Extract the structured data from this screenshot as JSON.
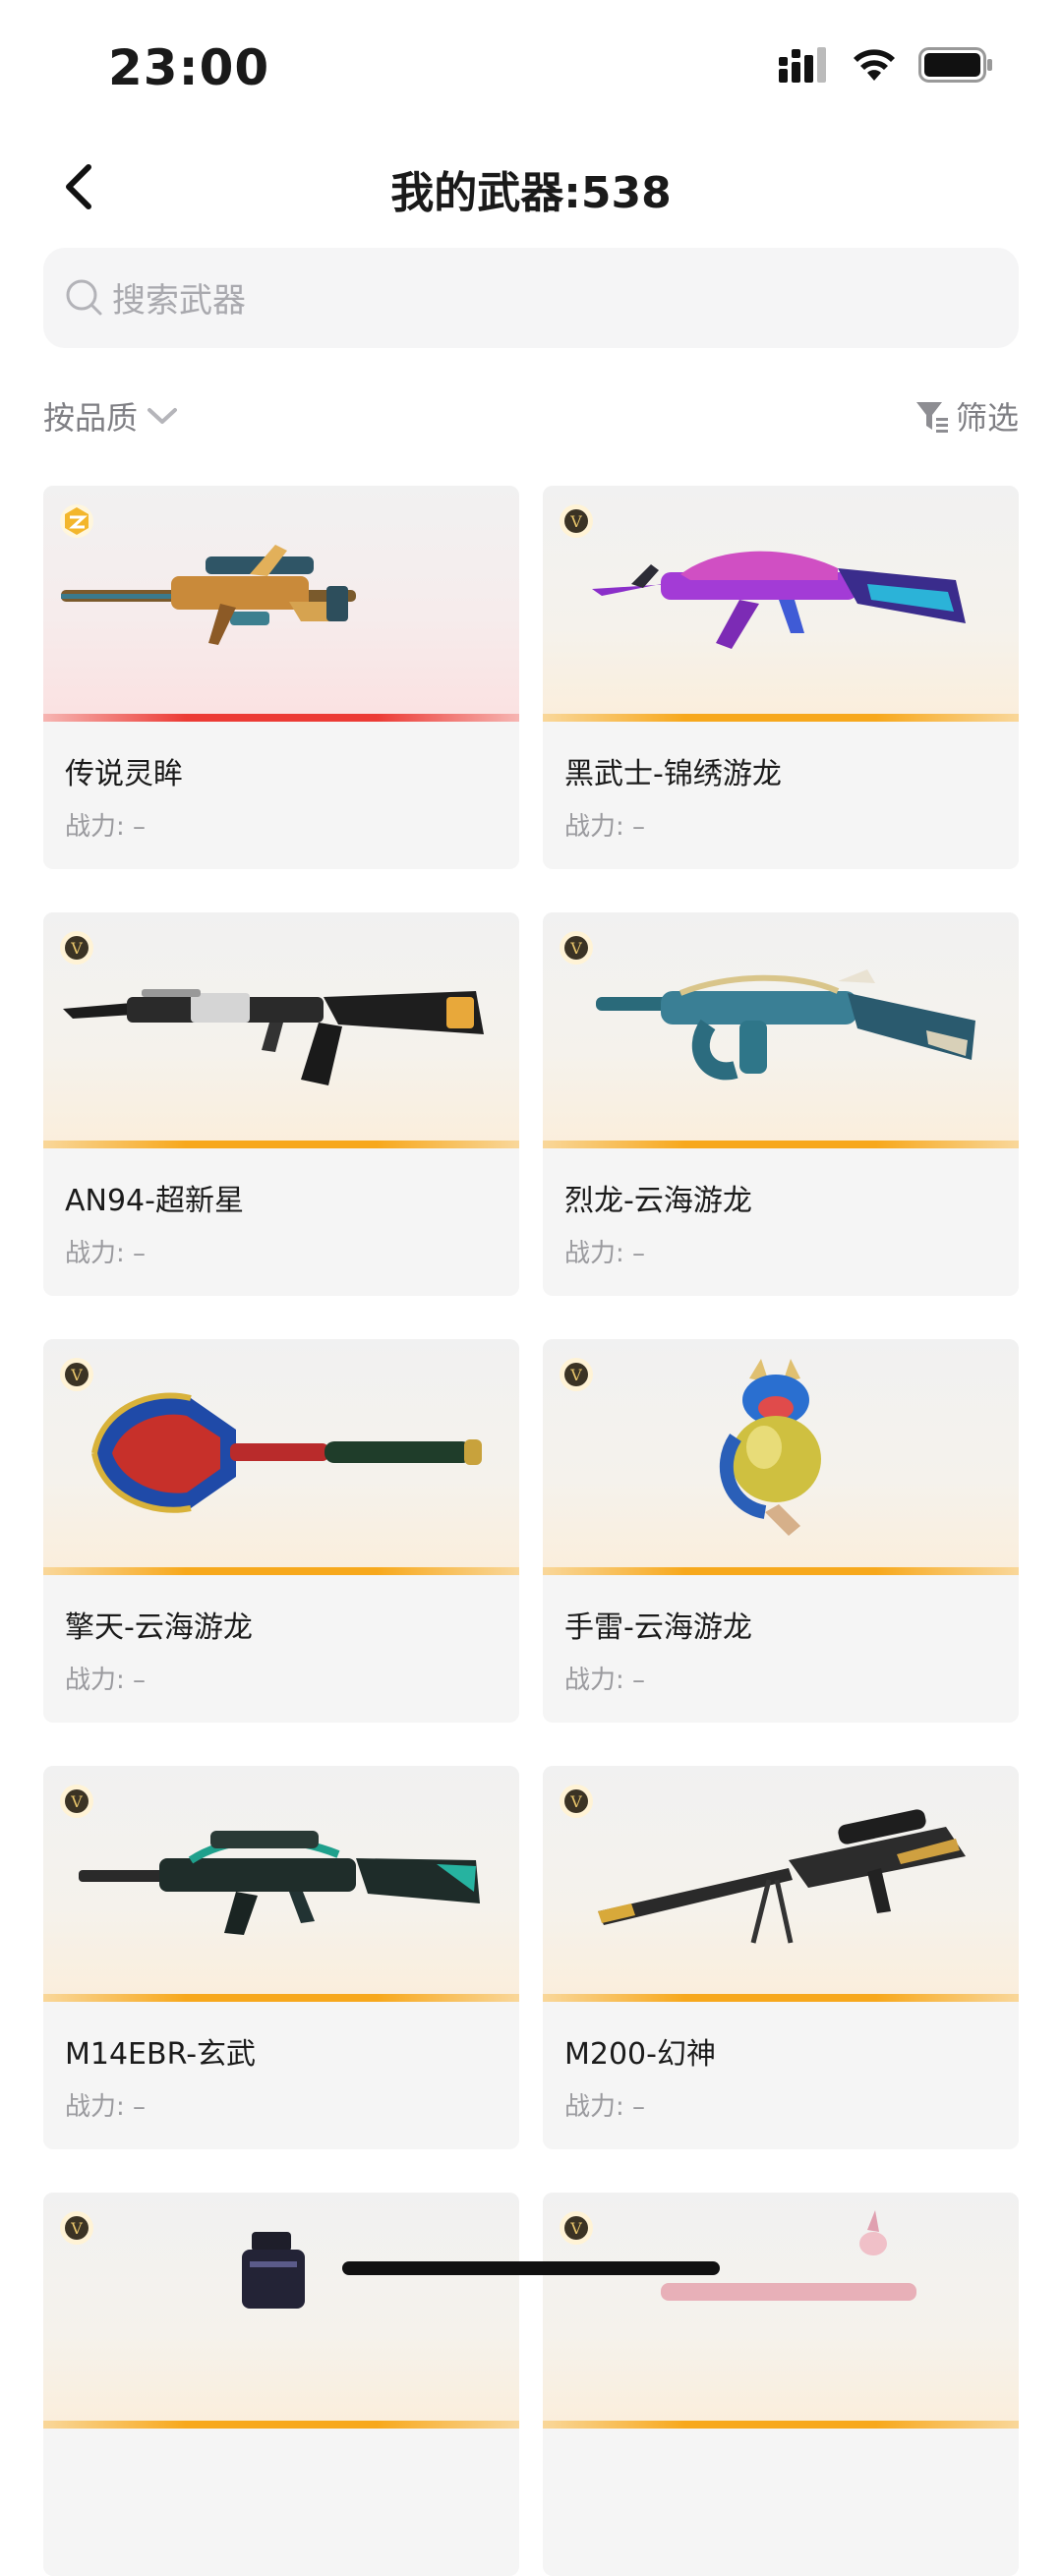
{
  "status": {
    "time": "23:00"
  },
  "nav": {
    "title": "我的武器:538"
  },
  "search": {
    "placeholder": "搜索武器"
  },
  "toolbar": {
    "sort_label": "按品质",
    "filter_label": "筛选"
  },
  "colors": {
    "accent_orange": "#F7A81C",
    "legend_red": "#EC3B35",
    "badge_gold": "#D9B24A"
  },
  "weapons": [
    {
      "name": "传说灵眸",
      "power": "战力: –",
      "rarity": "legend"
    },
    {
      "name": "黑武士-锦绣游龙",
      "power": "战力: –",
      "rarity": "v"
    },
    {
      "name": "AN94-超新星",
      "power": "战力: –",
      "rarity": "v"
    },
    {
      "name": "烈龙-云海游龙",
      "power": "战力: –",
      "rarity": "v"
    },
    {
      "name": "擎天-云海游龙",
      "power": "战力: –",
      "rarity": "v"
    },
    {
      "name": "手雷-云海游龙",
      "power": "战力: –",
      "rarity": "v"
    },
    {
      "name": "M14EBR-玄武",
      "power": "战力: –",
      "rarity": "v"
    },
    {
      "name": "M200-幻神",
      "power": "战力: –",
      "rarity": "v"
    },
    {
      "name": "",
      "power": "",
      "rarity": "v"
    },
    {
      "name": "",
      "power": "",
      "rarity": "v"
    }
  ]
}
